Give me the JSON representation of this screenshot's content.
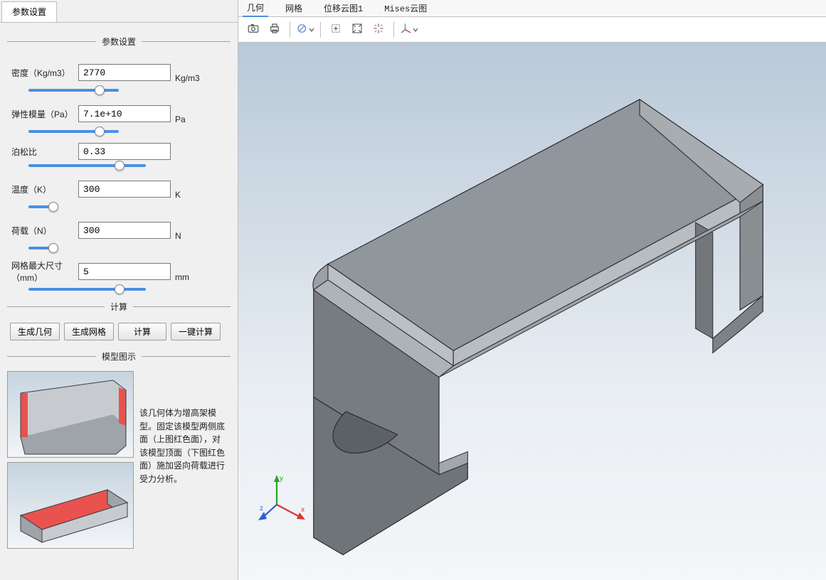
{
  "left": {
    "tab_label": "参数设置",
    "fieldset1_legend": "参数设置",
    "params": {
      "density": {
        "label": "密度（Kg/m3）",
        "value": "2770",
        "unit": "Kg/m3",
        "slider": 50
      },
      "modulus": {
        "label": "弹性模量（Pa）",
        "value": "7.1e+10",
        "unit": "Pa",
        "slider": 50
      },
      "poisson": {
        "label": "泊松比",
        "value": "0.33",
        "unit": "",
        "slider": 65
      },
      "temp": {
        "label": "温度（K）",
        "value": "300",
        "unit": "K",
        "slider": 15
      },
      "load": {
        "label": "荷载（N）",
        "value": "300",
        "unit": "N",
        "slider": 15
      },
      "mesh": {
        "label": "网格最大尺寸（mm）",
        "value": "5",
        "unit": "mm",
        "slider": 65
      }
    },
    "fieldset2_legend": "计算",
    "buttons": {
      "gen_geom": "生成几何",
      "gen_mesh": "生成网格",
      "compute": "计算",
      "one_key": "一键计算"
    },
    "fieldset3_legend": "模型图示",
    "model_description": "该几何体为增高架模型。固定该模型两侧底面（上图红色面），对该模型顶面（下图红色面）施加竖向荷载进行受力分析。"
  },
  "right": {
    "tabs": {
      "t1": "几何",
      "t2": "网格",
      "t3": "位移云图1",
      "t4": "Mises云图"
    }
  }
}
